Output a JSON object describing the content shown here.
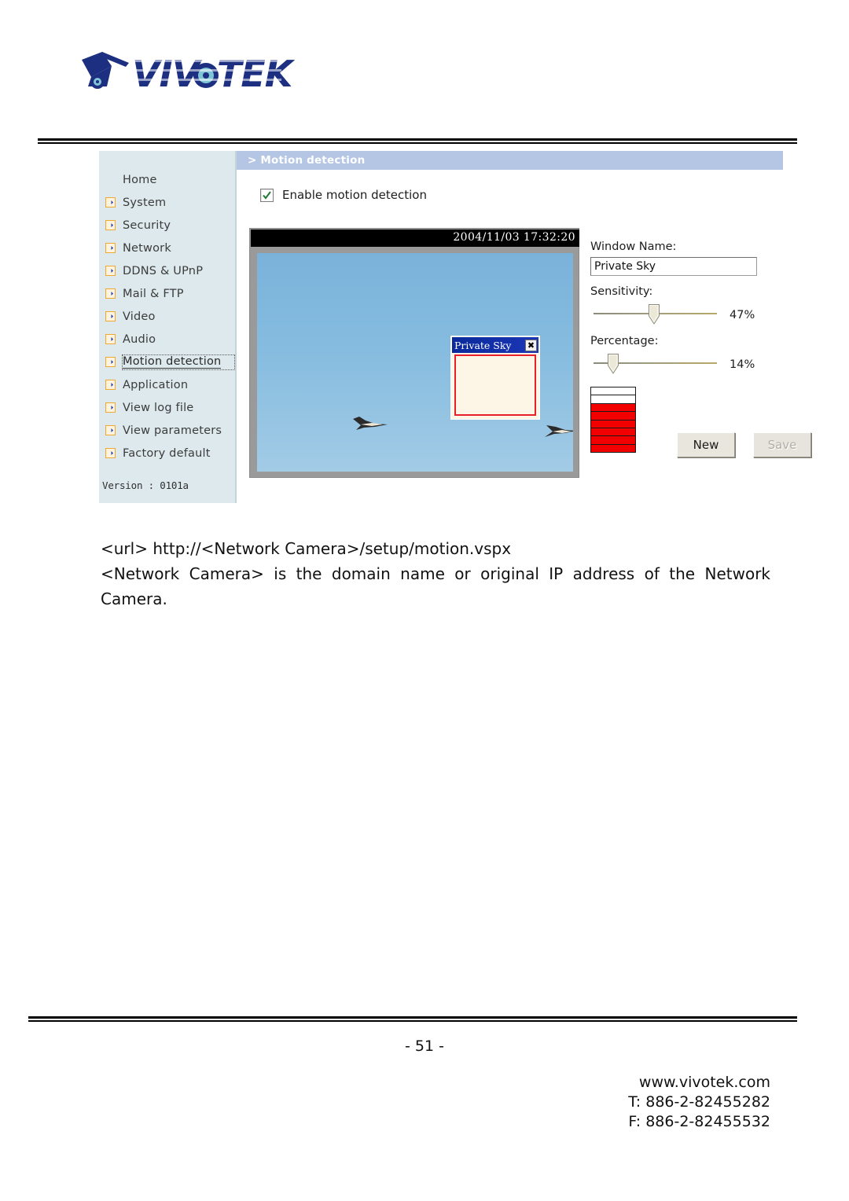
{
  "brand": {
    "logo_text": "VIVOTEK",
    "logo_icon": "camera-logo-icon"
  },
  "ui": {
    "sidebar": {
      "items": [
        {
          "label": "Home",
          "has_bullet": false,
          "active": false
        },
        {
          "label": "System",
          "has_bullet": true,
          "active": false
        },
        {
          "label": "Security",
          "has_bullet": true,
          "active": false
        },
        {
          "label": "Network",
          "has_bullet": true,
          "active": false
        },
        {
          "label": "DDNS & UPnP",
          "has_bullet": true,
          "active": false
        },
        {
          "label": "Mail & FTP",
          "has_bullet": true,
          "active": false
        },
        {
          "label": "Video",
          "has_bullet": true,
          "active": false
        },
        {
          "label": "Audio",
          "has_bullet": true,
          "active": false
        },
        {
          "label": "Motion detection",
          "has_bullet": true,
          "active": true
        },
        {
          "label": "Application",
          "has_bullet": true,
          "active": false
        },
        {
          "label": "View log file",
          "has_bullet": true,
          "active": false
        },
        {
          "label": "View parameters",
          "has_bullet": true,
          "active": false
        },
        {
          "label": "Factory default",
          "has_bullet": true,
          "active": false
        }
      ],
      "version": "Version : 0101a"
    },
    "pane": {
      "title": "> Motion detection",
      "enable_checkbox": {
        "label": "Enable motion detection",
        "checked": true
      }
    },
    "video": {
      "timestamp": "2004/11/03 17:32:20",
      "detection_window": {
        "title": "Private Sky",
        "close_label": "✖"
      }
    },
    "controls": {
      "window_name_label": "Window Name:",
      "window_name_value": "Private Sky",
      "window_name_placeholder": "Window Name",
      "sensitivity_label": "Sensitivity:",
      "sensitivity_value": "47%",
      "sensitivity_pct": 47,
      "percentage_label": "Percentage:",
      "percentage_value": "14%",
      "percentage_pct": 14,
      "meter_segments": 8,
      "meter_filled": 6,
      "new_button": "New",
      "save_button": "Save"
    },
    "colors": {
      "sidebar_bg": "#dde9ed",
      "pane_header_bg": "#b5c6e5",
      "accent_bullet": "#f0a92e",
      "meter_fill": "#f20000",
      "detection_border": "#e8202a",
      "titlebar_blue": "#0a2a9c"
    }
  },
  "body": {
    "url_line": "<url> http://<Network Camera>/setup/motion.vspx",
    "description": "<Network Camera> is the domain name or original IP address of the Network Camera."
  },
  "footer": {
    "page_number": "- 51 -",
    "website": "www.vivotek.com",
    "tel": "T: 886-2-82455282",
    "fax": "F: 886-2-82455532"
  }
}
